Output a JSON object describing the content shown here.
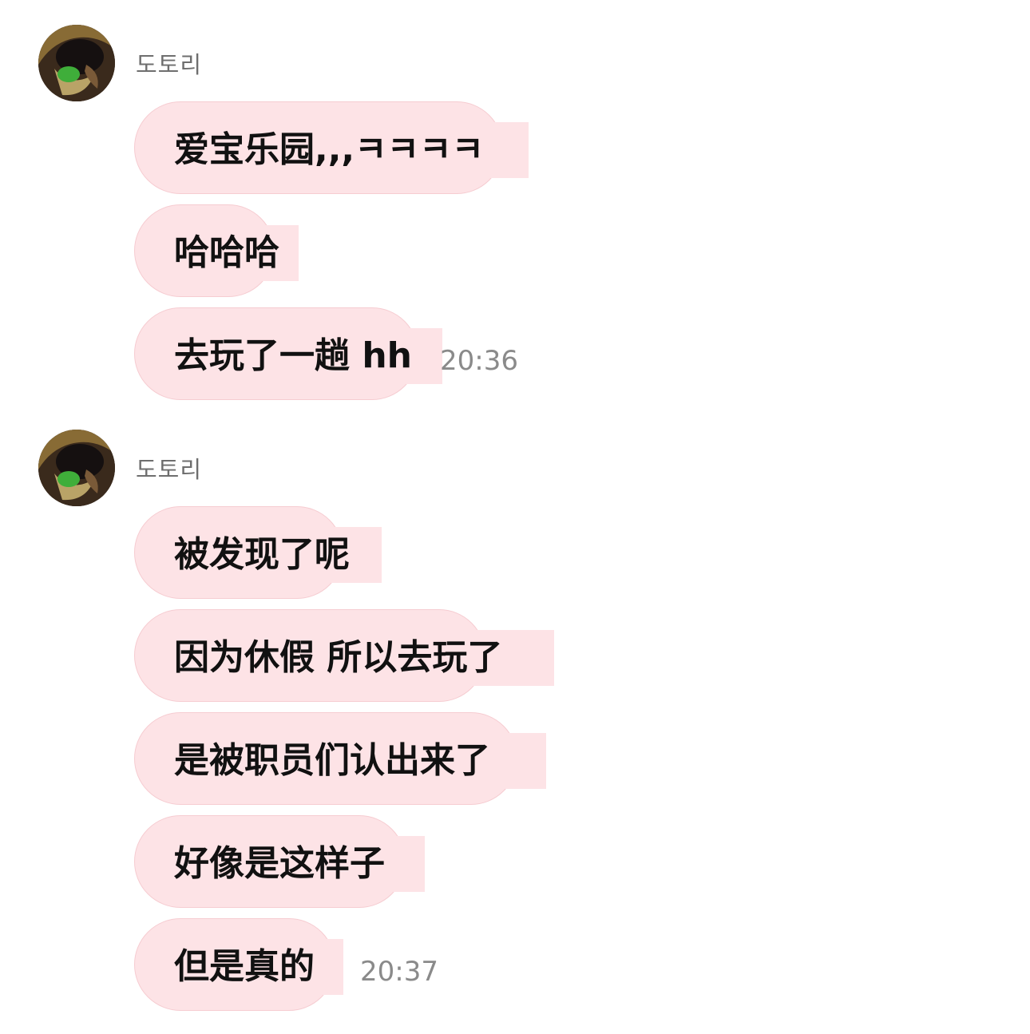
{
  "groups": [
    {
      "sender": "도토리",
      "avatar": "profile-avatar",
      "messages": [
        {
          "text": "爱宝乐园,,,ㅋㅋㅋㅋ"
        },
        {
          "text": "哈哈哈"
        },
        {
          "text": "去玩了一趟 hh"
        }
      ],
      "timestamp": "20:36"
    },
    {
      "sender": "도토리",
      "avatar": "profile-avatar",
      "messages": [
        {
          "text": "被发现了呢"
        },
        {
          "text": "因为休假 所以去玩了"
        },
        {
          "text": "是被职员们认出来了"
        },
        {
          "text": "好像是这样子"
        },
        {
          "text": "但是真的"
        }
      ],
      "timestamp": "20:37"
    }
  ],
  "colors": {
    "bubble": "#fde3e6",
    "bubble_border": "#f6ccd1",
    "text": "#111111",
    "sender": "#6e6e6e",
    "timestamp": "#8a8a8a"
  }
}
